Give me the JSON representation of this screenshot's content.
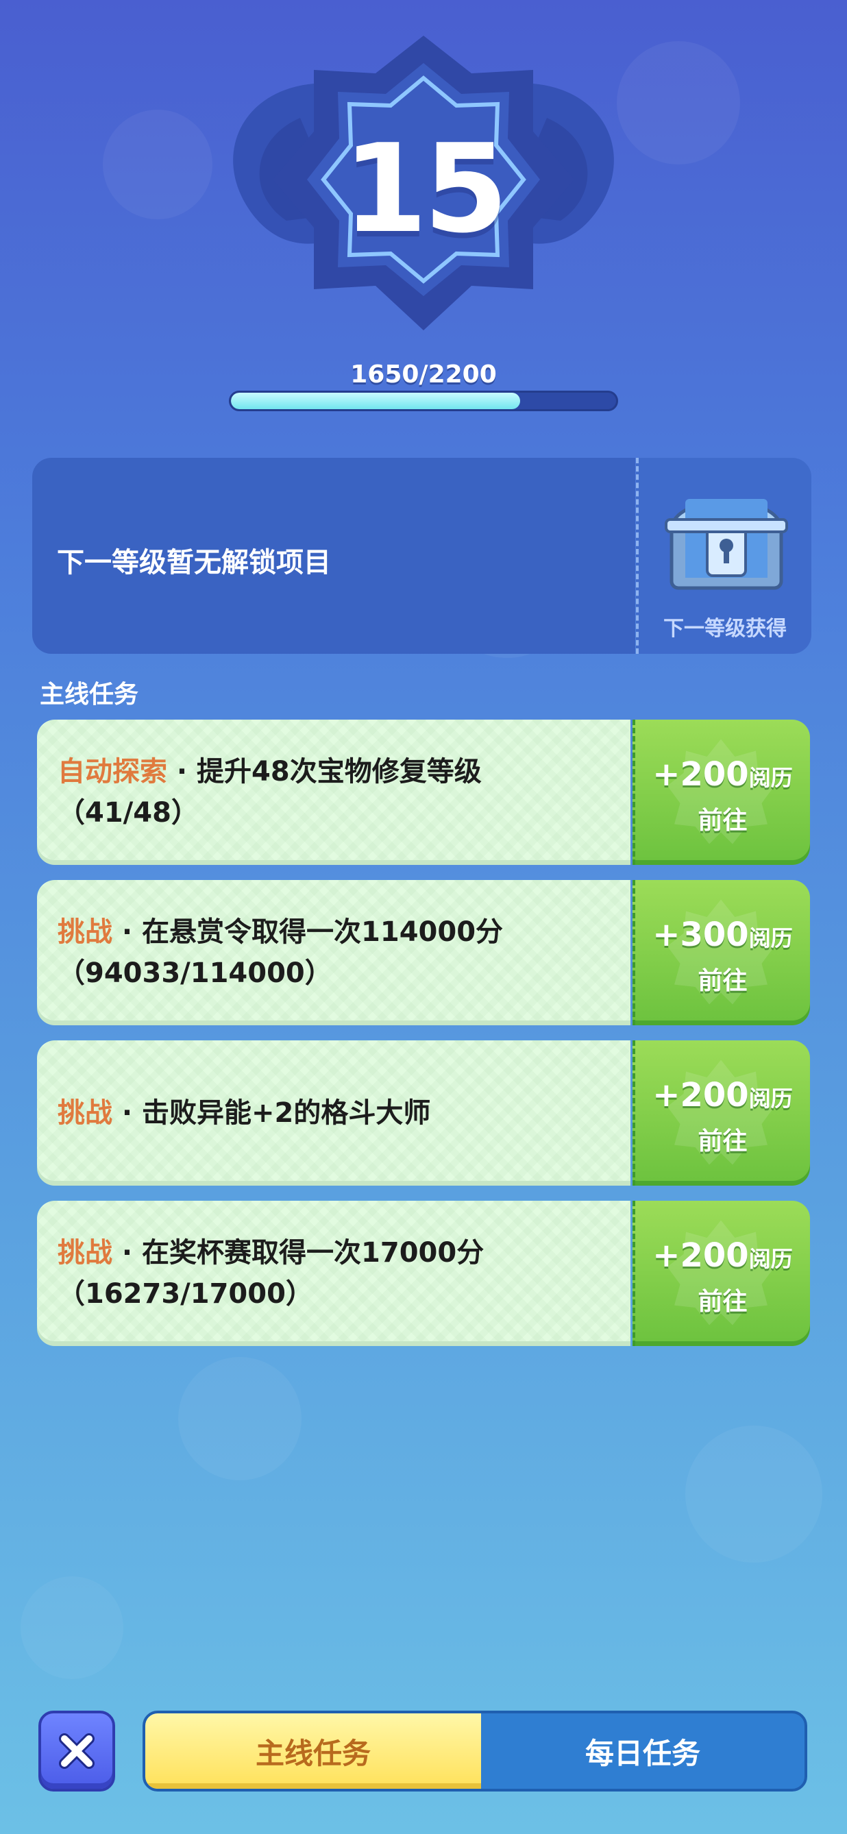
{
  "level": {
    "number": "15",
    "xp_text": "1650/2200",
    "xp_progress": 0.75
  },
  "next_level": {
    "message": "下一等级暂无解锁项目",
    "reward_label": "下一等级获得",
    "reward_icon": "treasure-chest-icon"
  },
  "section_title": "主线任务",
  "tasks": [
    {
      "category": "自动探索",
      "description": " · 提升48次宝物修复等级",
      "progress": "（41/48）",
      "reward_amount": "+200",
      "reward_unit": "阅历",
      "action": "前往"
    },
    {
      "category": "挑战",
      "description": " · 在悬赏令取得一次114000分",
      "progress": "（94033/114000）",
      "reward_amount": "+300",
      "reward_unit": "阅历",
      "action": "前往"
    },
    {
      "category": "挑战",
      "description": " · 击败异能+2的格斗大师",
      "progress": "",
      "reward_amount": "+200",
      "reward_unit": "阅历",
      "action": "前往"
    },
    {
      "category": "挑战",
      "description": " · 在奖杯赛取得一次17000分",
      "progress": "（16273/17000）",
      "reward_amount": "+200",
      "reward_unit": "阅历",
      "action": "前往"
    }
  ],
  "tabs": {
    "main": "主线任务",
    "daily": "每日任务"
  },
  "colors": {
    "category": "#e07a3e",
    "task_card": "#e2fbe0",
    "reward_green": "#7ccc46",
    "active_tab": "#ffe15a"
  }
}
